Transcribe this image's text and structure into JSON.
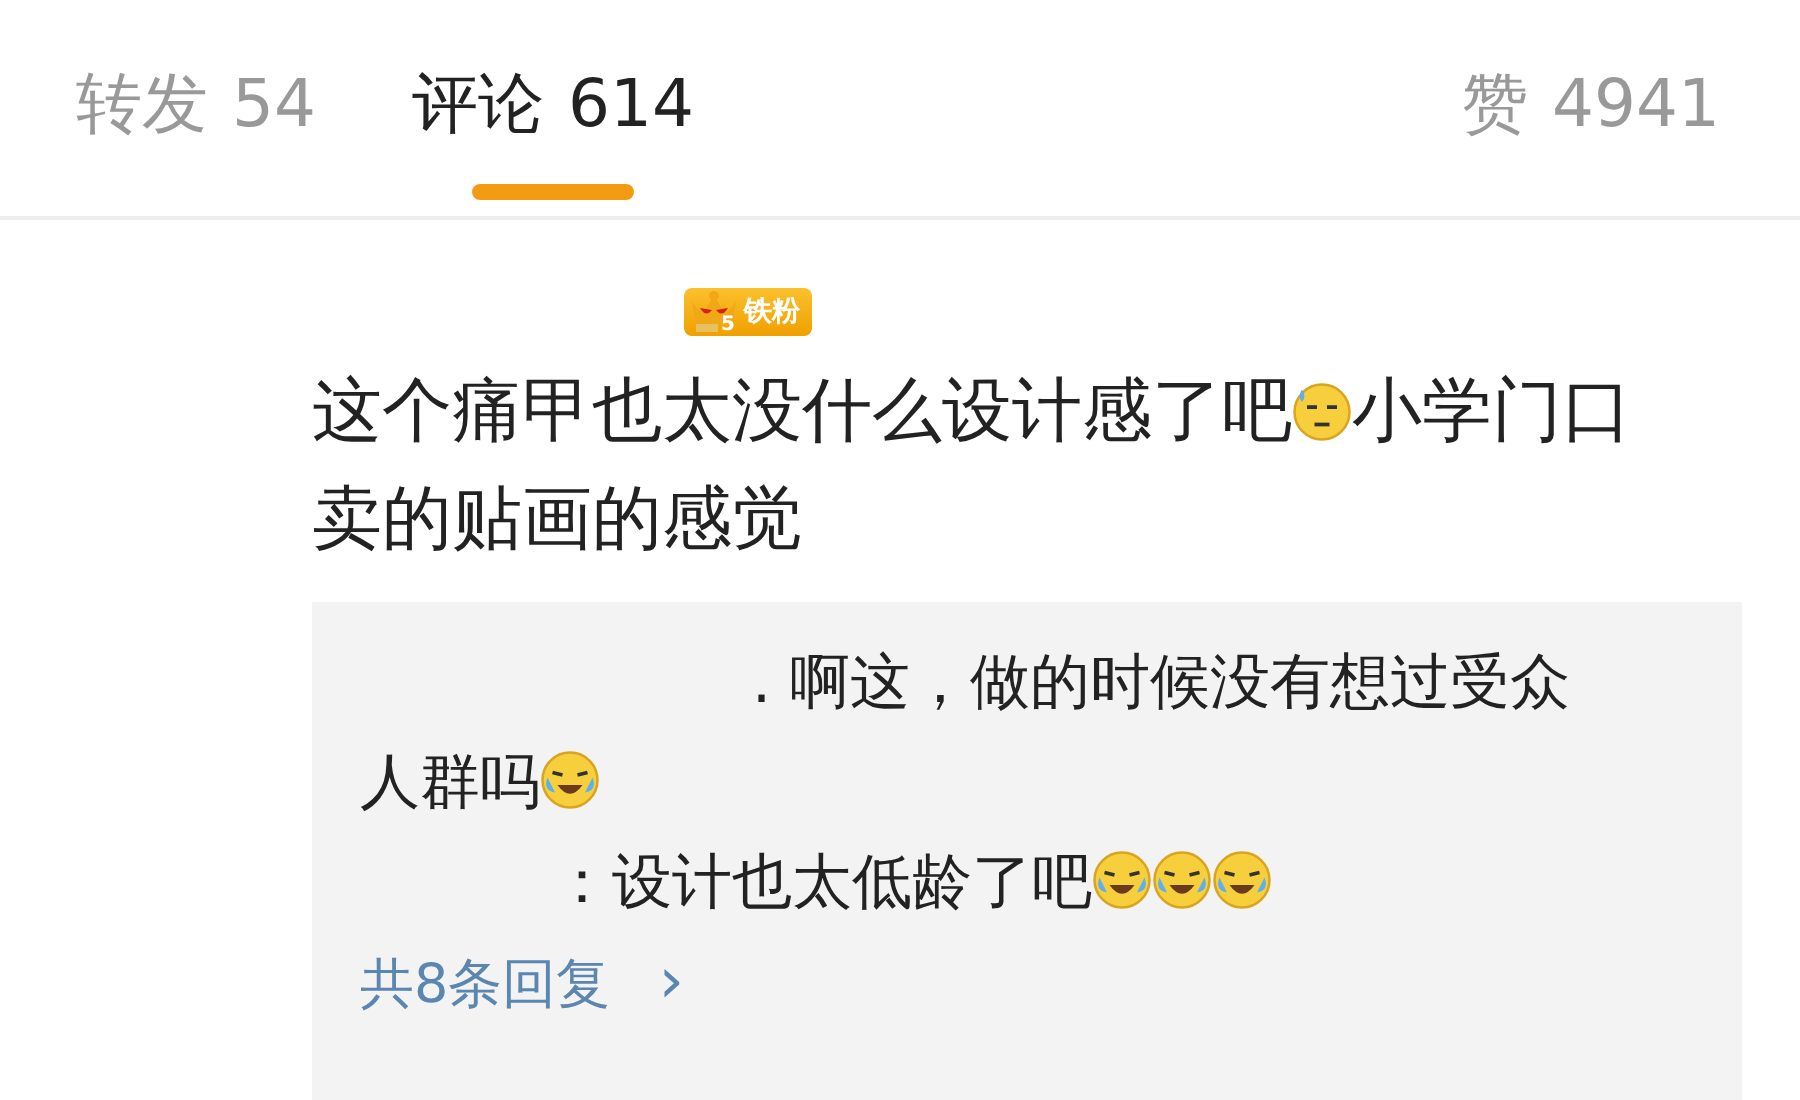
{
  "tabs": [
    {
      "label": "转发",
      "count": "54",
      "selected": false
    },
    {
      "label": "评论",
      "count": "614",
      "selected": true
    },
    {
      "label": "赞",
      "count": "4941",
      "selected": false
    }
  ],
  "comment": {
    "badge": "铁粉",
    "badge_level": "5",
    "segments": [
      {
        "kind": "text",
        "text": "这个痛甲也太没什么设计感了吧"
      },
      {
        "kind": "emoji-sweat"
      },
      {
        "kind": "text",
        "text": "小学门口"
      },
      {
        "kind": "text",
        "text": "卖的贴画的感觉"
      }
    ]
  },
  "replies": [
    {
      "segments": [
        {
          "kind": "text",
          "text": ". 啊这，做的时候没有想过受众"
        },
        {
          "kind": "text",
          "text": "人群吗"
        },
        {
          "kind": "emoji-laugh-cry"
        }
      ]
    },
    {
      "segments": [
        {
          "kind": "text",
          "text": "：设计也太低龄了吧"
        },
        {
          "kind": "emoji-laugh-cry"
        },
        {
          "kind": "emoji-laugh-cry"
        },
        {
          "kind": "emoji-laugh-cry"
        }
      ]
    }
  ],
  "more_replies": {
    "label": "共8条回复",
    "arrow": "›"
  }
}
